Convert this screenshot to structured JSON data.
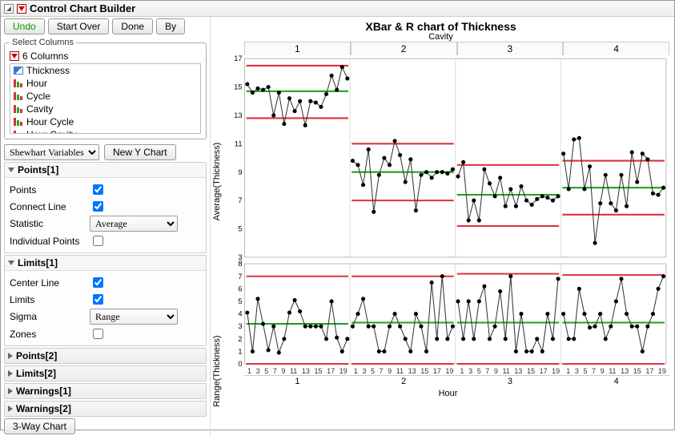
{
  "title": "Control Chart Builder",
  "buttons": {
    "undo": "Undo",
    "startOver": "Start Over",
    "done": "Done",
    "by": "By",
    "newY": "New Y Chart",
    "threeway": "3-Way Chart"
  },
  "columns": {
    "header": "Select Columns",
    "count": "6 Columns",
    "items": [
      {
        "name": "Thickness",
        "type": "cont"
      },
      {
        "name": "Hour",
        "type": "nom"
      },
      {
        "name": "Cycle",
        "type": "nom"
      },
      {
        "name": "Cavity",
        "type": "nom"
      },
      {
        "name": "Hour Cycle",
        "type": "nom"
      },
      {
        "name": "Hour Cavity",
        "type": "nom"
      }
    ]
  },
  "chartTypeCombo": "Shewhart Variables",
  "panels": {
    "points1": {
      "title": "Points[1]",
      "open": true,
      "points": "Points",
      "pointsChk": true,
      "connect": "Connect Line",
      "connectChk": true,
      "stat": "Statistic",
      "statVal": "Average",
      "indiv": "Individual Points",
      "indivChk": false
    },
    "limits1": {
      "title": "Limits[1]",
      "open": true,
      "center": "Center Line",
      "centerChk": true,
      "limits": "Limits",
      "limitsChk": true,
      "sigma": "Sigma",
      "sigmaVal": "Range",
      "zones": "Zones",
      "zonesChk": false
    },
    "points2": "Points[2]",
    "limits2": "Limits[2]",
    "warn1": "Warnings[1]",
    "warn2": "Warnings[2]"
  },
  "chart": {
    "title": "XBar & R chart of Thickness",
    "phaseLabel": "Cavity",
    "xlabel": "Hour",
    "ylabA": "Average(Thickness)",
    "ylabR": "Range(Thickness)",
    "phaseNames": [
      "1",
      "2",
      "3",
      "4"
    ],
    "hourTicks": [
      "1",
      "3",
      "5",
      "7",
      "9",
      "11",
      "13",
      "15",
      "17",
      "19"
    ]
  },
  "chart_data": {
    "type": "control-chart",
    "x_per_phase": [
      1,
      2,
      3,
      4,
      5,
      6,
      7,
      8,
      9,
      10,
      11,
      12,
      13,
      14,
      15,
      16,
      17,
      18,
      19,
      20
    ],
    "phases": [
      "1",
      "2",
      "3",
      "4"
    ],
    "top": {
      "stat": "Average",
      "ylim": [
        3,
        17
      ],
      "series": [
        {
          "phase": "1",
          "cl": 14.7,
          "ucl": 16.5,
          "lcl": 12.8,
          "values": [
            15.2,
            14.6,
            14.9,
            14.8,
            15.0,
            13.0,
            14.6,
            12.4,
            14.2,
            13.3,
            14.0,
            12.3,
            14.0,
            13.9,
            13.6,
            14.5,
            15.8,
            14.8,
            16.4,
            15.6
          ]
        },
        {
          "phase": "2",
          "cl": 9.0,
          "ucl": 11.0,
          "lcl": 7.0,
          "values": [
            9.8,
            9.5,
            8.1,
            10.6,
            6.2,
            8.8,
            10.0,
            9.5,
            11.2,
            10.2,
            8.3,
            9.9,
            6.3,
            8.8,
            9.0,
            8.6,
            9.0,
            9.0,
            8.9,
            9.2
          ]
        },
        {
          "phase": "3",
          "cl": 7.4,
          "ucl": 9.5,
          "lcl": 5.2,
          "values": [
            8.7,
            9.7,
            5.6,
            7.0,
            5.6,
            9.2,
            8.2,
            7.3,
            8.6,
            6.6,
            7.8,
            6.6,
            8.0,
            7.0,
            6.7,
            7.1,
            7.3,
            7.2,
            7.0,
            7.3
          ]
        },
        {
          "phase": "4",
          "cl": 7.9,
          "ucl": 9.8,
          "lcl": 6.0,
          "values": [
            10.3,
            7.8,
            11.3,
            11.4,
            7.8,
            9.4,
            4.0,
            6.8,
            8.8,
            6.8,
            6.3,
            8.8,
            6.6,
            10.4,
            8.3,
            10.3,
            9.9,
            7.5,
            7.4,
            7.9
          ]
        }
      ]
    },
    "bottom": {
      "stat": "Range",
      "ylim": [
        0,
        8
      ],
      "series": [
        {
          "phase": "1",
          "cl": 3.2,
          "ucl": 7.0,
          "lcl": 0,
          "values": [
            4.1,
            1.0,
            5.2,
            3.2,
            1.1,
            3.0,
            0.9,
            2.0,
            4.1,
            5.1,
            4.2,
            3.0,
            3.0,
            3.0,
            3.0,
            2.0,
            5.0,
            2.1,
            1.0,
            2.0
          ]
        },
        {
          "phase": "2",
          "cl": 3.3,
          "ucl": 7.0,
          "lcl": 0,
          "values": [
            3.0,
            4.0,
            5.2,
            3.0,
            3.0,
            1.0,
            1.0,
            3.0,
            4.0,
            3.0,
            2.0,
            1.0,
            4.0,
            3.0,
            1.0,
            6.5,
            2.0,
            7.0,
            2.0,
            3.0
          ]
        },
        {
          "phase": "3",
          "cl": 3.3,
          "ucl": 7.2,
          "lcl": 0,
          "values": [
            5.0,
            2.0,
            5.0,
            2.0,
            5.0,
            6.2,
            2.0,
            3.0,
            5.8,
            2.0,
            7.0,
            1.0,
            4.0,
            1.0,
            1.0,
            2.0,
            1.0,
            4.0,
            2.0,
            6.8
          ]
        },
        {
          "phase": "4",
          "cl": 3.3,
          "ucl": 7.1,
          "lcl": 0,
          "values": [
            4.0,
            2.0,
            2.0,
            6.0,
            4.0,
            2.9,
            3.0,
            4.0,
            2.0,
            3.0,
            5.0,
            6.8,
            4.0,
            3.0,
            3.0,
            1.0,
            3.0,
            4.0,
            6.0,
            7.0
          ]
        }
      ]
    }
  }
}
